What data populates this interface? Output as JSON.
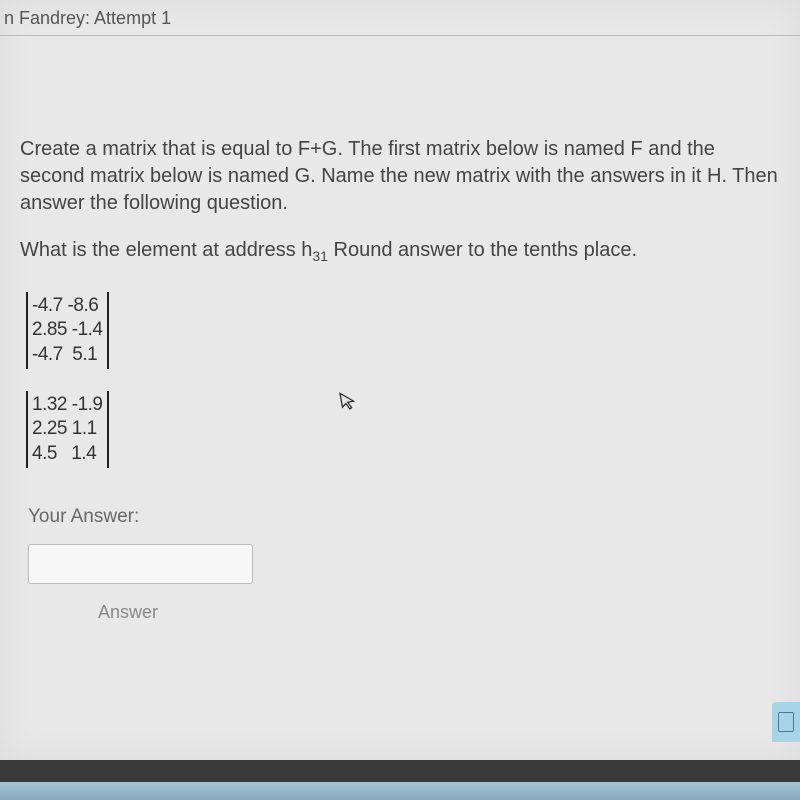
{
  "header": {
    "breadcrumb": "n Fandrey: Attempt 1"
  },
  "question": {
    "paragraph": "Create a matrix that is equal to F+G. The first matrix below is named F and the second matrix below is named G. Name the new matrix with the answers in it H. Then answer the following question.",
    "prompt_prefix": "What is the element at address h",
    "prompt_subscript": "31",
    "prompt_suffix": " Round answer to the tenths place."
  },
  "matrix_F": {
    "rows": [
      "-4.7 -8.6",
      "2.85 -1.4",
      "-4.7  5.1"
    ]
  },
  "matrix_G": {
    "rows": [
      "1.32 -1.9",
      "2.25 1.1",
      "4.5   1.4"
    ]
  },
  "answer": {
    "label": "Your Answer:",
    "value": "",
    "caption": "Answer"
  }
}
